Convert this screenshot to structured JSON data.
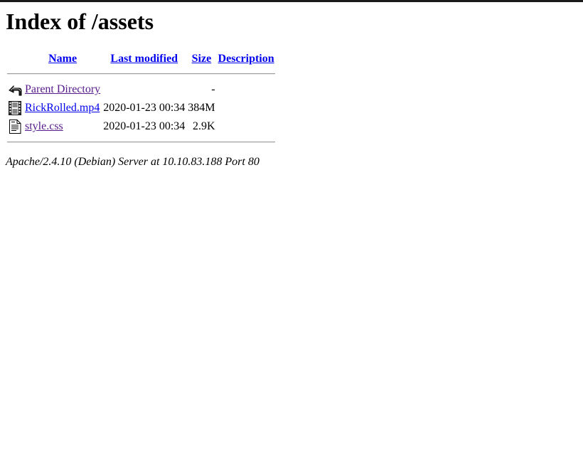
{
  "page": {
    "title": "Index of /assets"
  },
  "table": {
    "headers": {
      "name": "Name",
      "last_modified": "Last modified",
      "size": "Size",
      "description": "Description"
    },
    "rows": [
      {
        "icon": "back-arrow-icon",
        "name": "Parent Directory",
        "last_modified": "",
        "size": "-",
        "description": ""
      },
      {
        "icon": "movie-icon",
        "name": "RickRolled.mp4",
        "last_modified": "2020-01-23 00:34",
        "size": "384M",
        "description": ""
      },
      {
        "icon": "text-file-icon",
        "name": "style.css",
        "last_modified": "2020-01-23 00:34",
        "size": "2.9K",
        "description": ""
      }
    ]
  },
  "footer": {
    "address": "Apache/2.4.10 (Debian) Server at 10.10.83.188 Port 80"
  }
}
